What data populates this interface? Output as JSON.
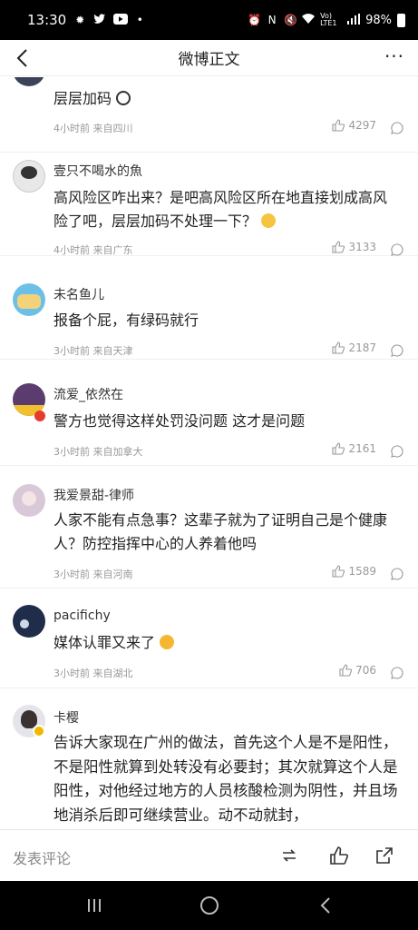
{
  "status_bar": {
    "time": "13:30",
    "battery": "98%",
    "network": "Vo) LTE1",
    "icons": [
      "sun-icon",
      "twitter-icon",
      "youtube-icon",
      "dot-icon",
      "alarm-icon",
      "nfc-icon",
      "mute-icon",
      "wifi-icon",
      "signal-icon",
      "battery-icon"
    ]
  },
  "nav": {
    "title": "微博正文",
    "back_icon": "chevron-left-icon",
    "more_icon": "more-icon"
  },
  "comments": [
    {
      "author": "",
      "text": "层层加码",
      "emoji": "panda-face",
      "time": "4小时前",
      "location": "来自四川",
      "likes": "4297"
    },
    {
      "author": "壹只不喝水的魚",
      "text": "高风险区咋出来？是吧高风险区所在地直接划成高风险了吧，层层加码不处理一下？",
      "emoji": "thinking-face",
      "time": "4小时前",
      "location": "来自广东",
      "likes": "3133"
    },
    {
      "author": "未名鱼儿",
      "text": "报备个屁，有绿码就行",
      "time": "3小时前",
      "location": "来自天津",
      "likes": "2187"
    },
    {
      "author": "流爱_依然在",
      "text": "警方也觉得这样处罚没问题 这才是问题",
      "time": "3小时前",
      "location": "来自加拿大",
      "likes": "2161"
    },
    {
      "author": "我爱景甜-律师",
      "text": "人家不能有点急事？这辈子就为了证明自己是个健康人？防控指挥中心的人养着他吗",
      "time": "3小时前",
      "location": "来自河南",
      "likes": "1589"
    },
    {
      "author": "pacifichy",
      "text": "媒体认罪又来了",
      "emoji": "heart-eyes",
      "time": "3小时前",
      "location": "来自湖北",
      "likes": "706"
    },
    {
      "author": "卡樱",
      "text": "告诉大家现在广州的做法，首先这个人是不是阳性，不是阳性就算到处转没有必要封；其次就算这个人是阳性，对他经过地方的人员核酸检测为阴性，并且场地消杀后即可继续营业。动不动就封，",
      "time": "",
      "location": "",
      "likes": ""
    }
  ],
  "bottom_bar": {
    "placeholder": "发表评论",
    "icons": [
      "repost-icon",
      "like-icon",
      "share-icon"
    ]
  },
  "colors": {
    "text": "#222222",
    "meta": "#999999",
    "accent": "#ff8200",
    "verified": "#f0b900"
  }
}
